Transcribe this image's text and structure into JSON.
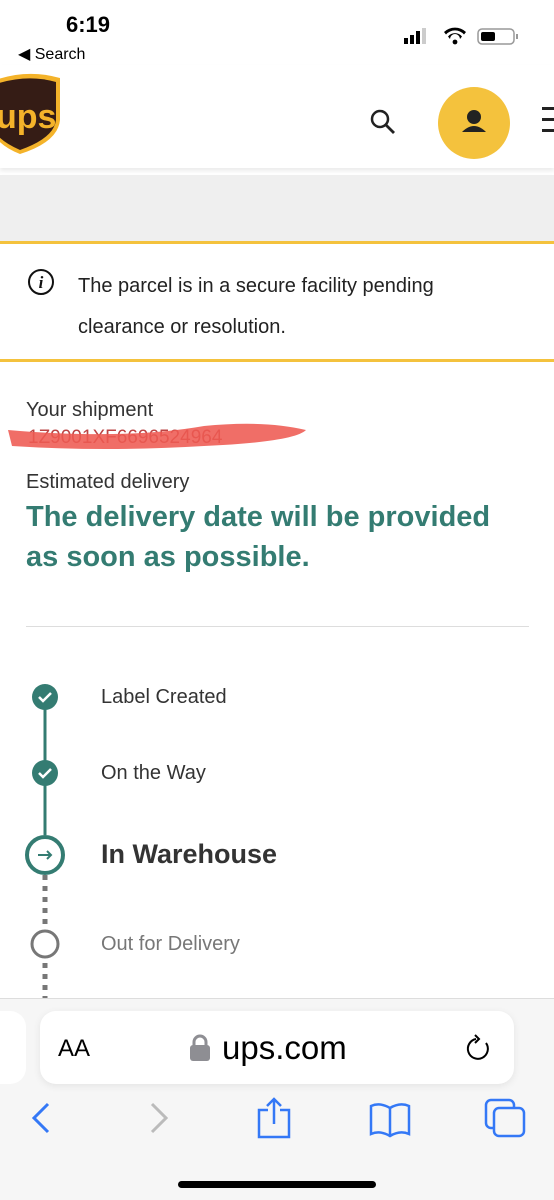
{
  "status_bar": {
    "time": "6:19",
    "back_label": "◀ Search"
  },
  "header": {
    "logo_text": "ups"
  },
  "alert": {
    "message": "The parcel is in a secure facility pending clearance or resolution."
  },
  "shipment": {
    "label": "Your shipment",
    "tracking_number": "1Z9001XF6696524964",
    "estimated_label": "Estimated delivery",
    "estimated_value": "The delivery date will be provided as soon as possible."
  },
  "progress": {
    "steps": [
      {
        "label": "Label Created",
        "state": "done"
      },
      {
        "label": "On the Way",
        "state": "done"
      },
      {
        "label": "In Warehouse",
        "state": "current"
      },
      {
        "label": "Out for Delivery",
        "state": "pending"
      }
    ]
  },
  "browser": {
    "text_size": "AA",
    "url": "ups.com"
  },
  "colors": {
    "brand_brown": "#351c15",
    "brand_yellow": "#f4c23d",
    "accent_green": "#347c72",
    "ios_blue": "#3478f6"
  }
}
